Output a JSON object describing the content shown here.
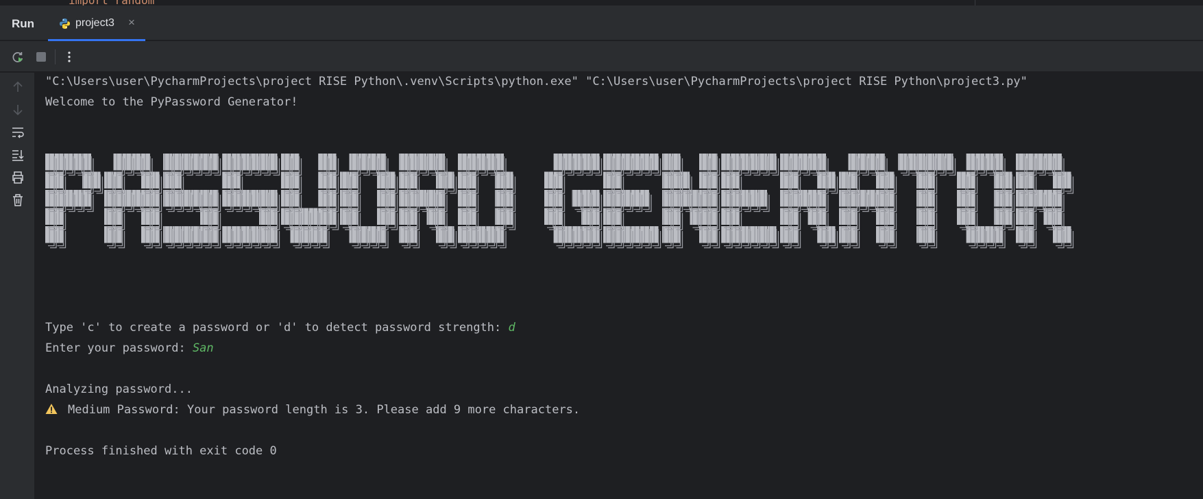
{
  "editor_fragment": "import random",
  "panel": {
    "title": "Run"
  },
  "tab": {
    "label": "project3",
    "close_glyph": "×",
    "icon": "python-icon"
  },
  "toolbar": {
    "buttons": [
      "rerun-icon",
      "stop-icon",
      "more-options-icon"
    ]
  },
  "gutter": {
    "icons": [
      "scroll-up-icon",
      "scroll-down-icon",
      "soft-wrap-icon",
      "scroll-to-end-icon",
      "print-icon",
      "clear-all-icon"
    ]
  },
  "console": {
    "command": "\"C:\\Users\\user\\PycharmProjects\\project RISE Python\\.venv\\Scripts\\python.exe\" \"C:\\Users\\user\\PycharmProjects\\project RISE Python\\project3.py\"",
    "welcome": "Welcome to the PyPassword Generator!",
    "banner_text": "PASSWORD GENERATOR",
    "prompt1": "Type 'c' to create a password or 'd' to detect password strength: ",
    "input1": "d",
    "prompt2": "Enter your password: ",
    "input2": "San",
    "analyzing": "Analyzing password...",
    "warning": "Medium Password: Your password length is 3. Please add 9 more characters.",
    "finished": "Process finished with exit code 0"
  },
  "colors": {
    "background": "#1e1f22",
    "panel": "#2b2d30",
    "accent": "#3574f0",
    "user_input": "#5fb865",
    "warning": "#f2c55c"
  }
}
